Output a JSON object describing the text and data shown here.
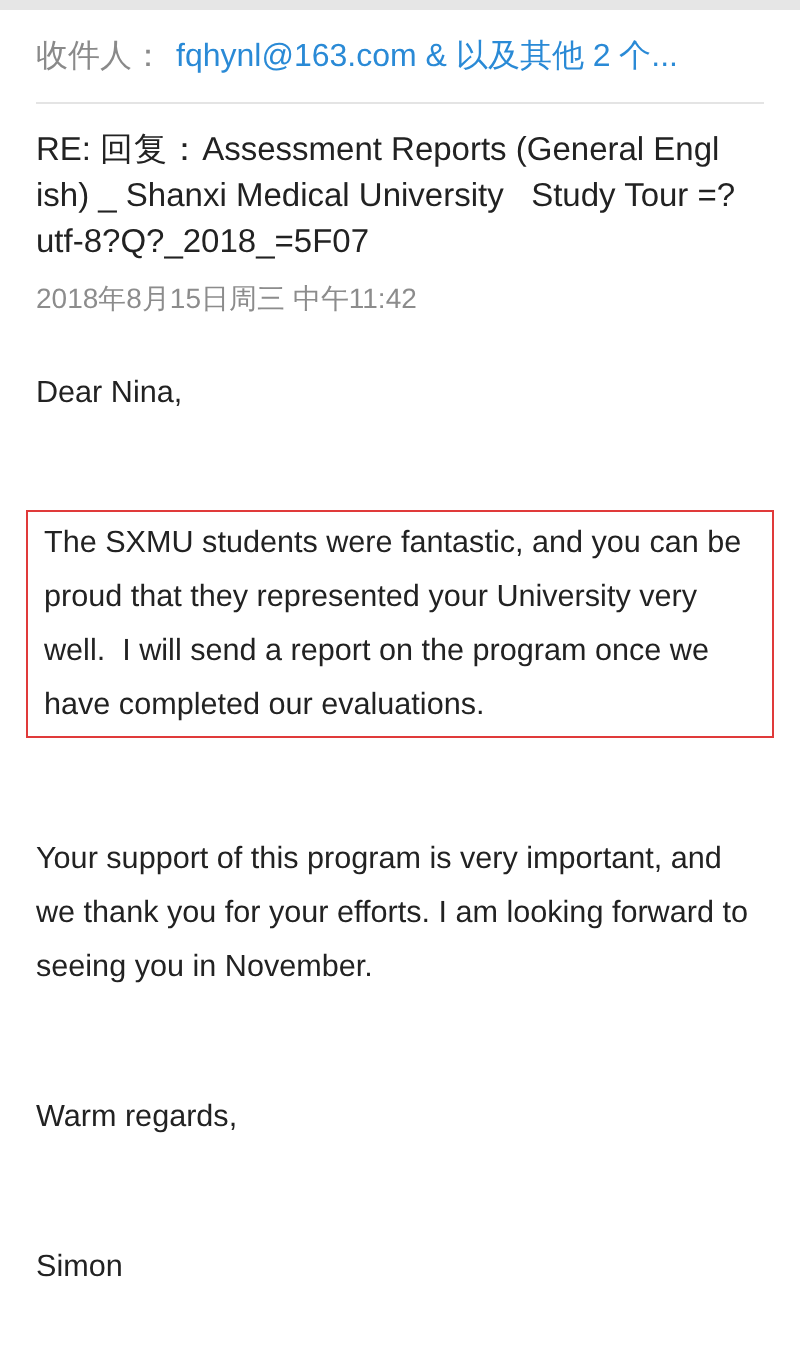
{
  "recipients": {
    "label": "收件人：",
    "value": "fqhynl@163.com & 以及其他 2 个..."
  },
  "subject_lines": [
    "RE: 回复：Assessment Reports (General Engl",
    "ish) _ Shanxi Medical University   Study Tour =?",
    "utf-8?Q?_2018_=5F07"
  ],
  "date": "2018年8月15日周三 中午11:42",
  "body": [
    {
      "text": "Dear Nina,",
      "highlighted": false
    },
    {
      "text": "The SXMU students were fantastic, and you can be proud that they represented your University very well.  I will send a report on the program once we have completed our evaluations.",
      "highlighted": true
    },
    {
      "text": "Your support of this program is very important, and we thank you for your efforts. I am looking forward to seeing you in November.",
      "highlighted": false
    },
    {
      "text": "Warm regards,",
      "highlighted": false
    },
    {
      "text": "Simon",
      "highlighted": false
    }
  ]
}
